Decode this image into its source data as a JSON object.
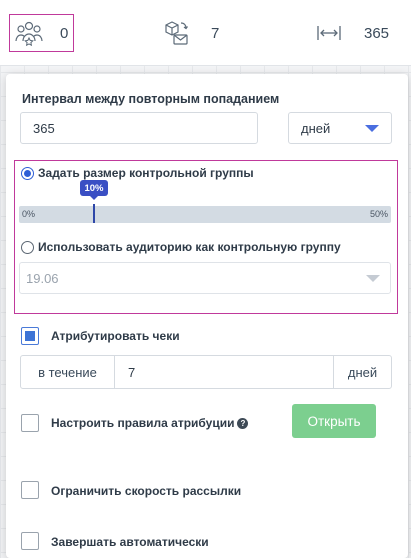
{
  "stats": {
    "audience": {
      "value": "0",
      "icon": "people-icon"
    },
    "messages": {
      "value": "7",
      "icon": "messages-icon"
    },
    "interval": {
      "value": "365",
      "icon": "interval-icon"
    }
  },
  "interval": {
    "title": "Интервал между повторным попаданием",
    "value": "365",
    "unit": "дней"
  },
  "control_group": {
    "option_size_label": "Задать размер контрольной группы",
    "option_size_selected": true,
    "slider": {
      "min_label": "0%",
      "max_label": "50%",
      "value_label": "10%",
      "value": 10,
      "max": 50
    },
    "option_audience_label": "Использовать аудиторию как контрольную группу",
    "audience_value": "19.06"
  },
  "attribution": {
    "checkbox_label": "Атрибутировать чеки",
    "checked": true,
    "prefix": "в течение",
    "value": "7",
    "suffix": "дней"
  },
  "attribution_rules": {
    "checkbox_label": "Настроить правила атрибуции",
    "help_glyph": "?",
    "open_button": "Открыть"
  },
  "limit_speed": {
    "checkbox_label": "Ограничить скорость рассылки"
  },
  "auto_finish": {
    "checkbox_label": "Завершать автоматически"
  },
  "colors": {
    "accent": "#3c73d6",
    "highlight": "#c0399b",
    "button_green": "#7ccf8f"
  }
}
